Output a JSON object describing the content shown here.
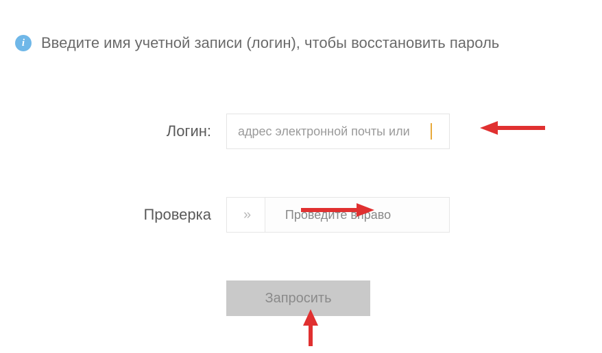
{
  "instruction": "Введите имя учетной записи (логин), чтобы восстановить пароль",
  "fields": {
    "login": {
      "label": "Логин:",
      "placeholder": "адрес электронной почты или"
    },
    "captcha": {
      "label": "Проверка",
      "slider_text": "Проведите вправо",
      "handle_glyph": "»"
    }
  },
  "submit_label": "Запросить",
  "info_glyph": "i",
  "colors": {
    "info_bg": "#6fb7e8",
    "arrow": "#e03030",
    "caret": "#e8a93a",
    "button_bg": "#c9c9c9"
  }
}
